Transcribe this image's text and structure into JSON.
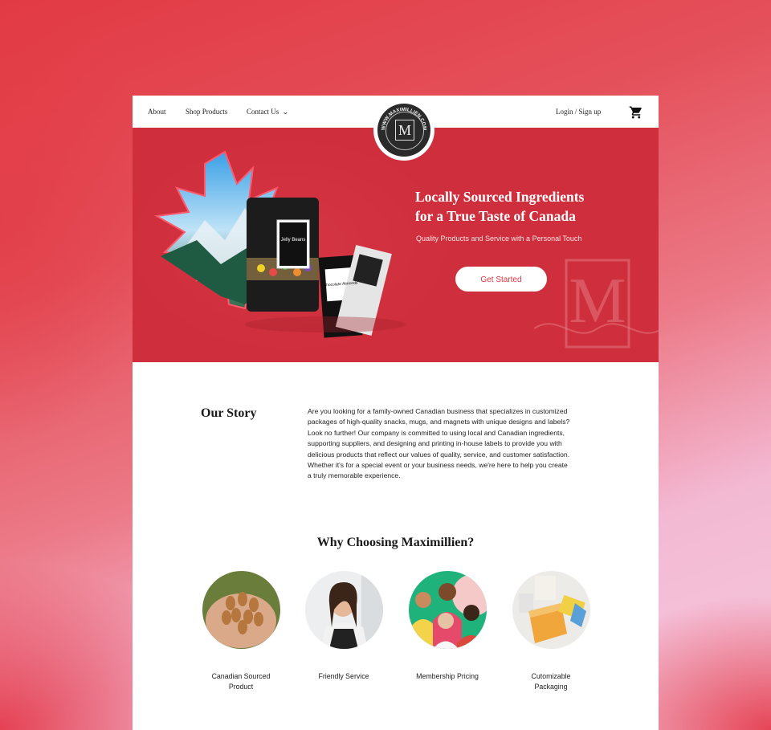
{
  "nav": {
    "about": "About",
    "shop": "Shop Products",
    "contact": "Contact Us",
    "login": "Login / Sign up"
  },
  "logo": {
    "text": "WWW.MAXIMILLIEN.COM",
    "monogram": "M"
  },
  "hero": {
    "title_line1": "Locally Sourced Ingredients",
    "title_line2": "for a True Taste of Canada",
    "subtitle": "Quality Products and Service with a Personal Touch",
    "cta": "Get Started",
    "product1": "Jelly Beans",
    "product2": "Chocolate Almonds"
  },
  "story": {
    "title": "Our Story",
    "lines": [
      "Are you looking for a family-owned Canadian business that specializes in customized",
      "packages of high-quality snacks, mugs, and magnets with unique designs and labels?",
      "Look no further! Our company is committed to using local and Canadian ingredients,",
      "supporting suppliers, and designing and printing in-house labels to provide you with",
      "delicious products that reflect our values of quality, service, and customer satisfaction.",
      "Whether it's for a special event or your business needs, we're here to help you create",
      "a truly memorable experience."
    ]
  },
  "why": {
    "title": "Why Choosing Maximillien?",
    "features": [
      {
        "label": "Canadian Sourced Product",
        "icon": "almonds-image"
      },
      {
        "label": "Friendly Service",
        "icon": "support-agent-image"
      },
      {
        "label": "Membership Pricing",
        "icon": "group-people-image"
      },
      {
        "label": "Cutomizable Packaging",
        "icon": "packaging-image"
      }
    ]
  },
  "colors": {
    "brand_red": "#cf2e3c",
    "white": "#ffffff"
  }
}
